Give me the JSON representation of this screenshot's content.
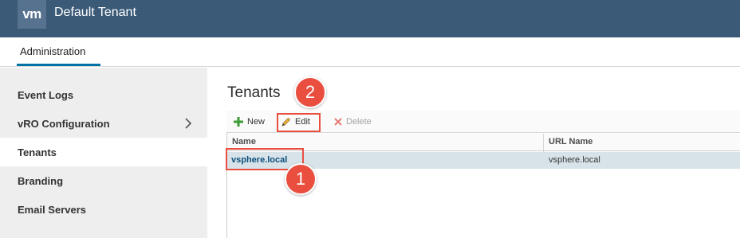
{
  "header": {
    "logo": "vm",
    "title": "Default Tenant"
  },
  "tabs": [
    {
      "label": "Administration"
    }
  ],
  "sidebar": {
    "items": [
      {
        "label": "Event Logs"
      },
      {
        "label": "vRO Configuration"
      },
      {
        "label": "Tenants"
      },
      {
        "label": "Branding"
      },
      {
        "label": "Email Servers"
      }
    ]
  },
  "main": {
    "title": "Tenants",
    "toolbar": {
      "new_label": "New",
      "edit_label": "Edit",
      "delete_label": "Delete"
    },
    "columns": [
      "Name",
      "URL Name"
    ],
    "rows": [
      {
        "name": "vsphere.local",
        "url_name": "vsphere.local"
      }
    ]
  },
  "annotations": [
    "1",
    "2"
  ],
  "colors": {
    "header": "#3b5a78",
    "accent": "#0072a3",
    "callout": "#e94e3f",
    "selected_row": "#d8e3e9"
  }
}
